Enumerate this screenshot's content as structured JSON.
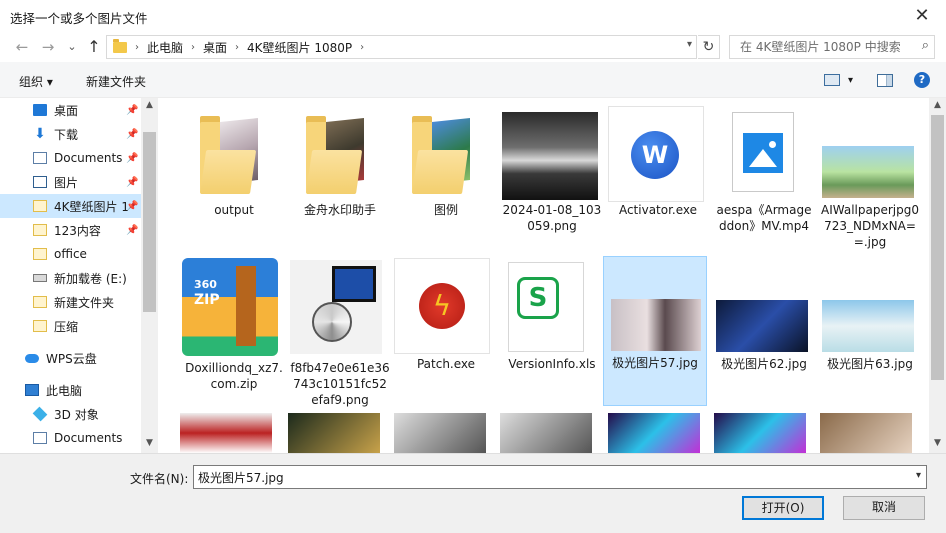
{
  "window": {
    "title": "选择一个或多个图片文件",
    "close": "✕"
  },
  "nav": {
    "back": "←",
    "forward": "→",
    "recent": "⌄",
    "up": "↑",
    "breadcrumbs": [
      "此电脑",
      "桌面",
      "4K壁纸图片 1080P"
    ],
    "separator": "›",
    "refresh": "↻",
    "search_placeholder": "在 4K壁纸图片 1080P 中搜索",
    "search_icon": "⌕"
  },
  "toolbar": {
    "organize": "组织 ▾",
    "new_folder": "新建文件夹",
    "view_dd": "▾",
    "help": "?"
  },
  "sidebar": {
    "items": [
      {
        "label": "桌面",
        "icon": "desktop-icon",
        "pinned": true
      },
      {
        "label": "下载",
        "icon": "download-icon",
        "pinned": true
      },
      {
        "label": "Documents",
        "icon": "document-icon",
        "pinned": true
      },
      {
        "label": "图片",
        "icon": "pictures-icon",
        "pinned": true
      },
      {
        "label": "4K壁纸图片 1",
        "icon": "folder-icon",
        "pinned": true
      },
      {
        "label": "123内容",
        "icon": "folder-icon",
        "pinned": true
      },
      {
        "label": "office",
        "icon": "folder-icon",
        "pinned": false
      },
      {
        "label": "新加载卷 (E:)",
        "icon": "drive-icon",
        "pinned": false
      },
      {
        "label": "新建文件夹",
        "icon": "folder-icon",
        "pinned": false
      },
      {
        "label": "压缩",
        "icon": "folder-icon",
        "pinned": false
      },
      {
        "label": "WPS云盘",
        "icon": "cloud-icon",
        "pinned": false
      },
      {
        "label": "此电脑",
        "icon": "pc-icon",
        "pinned": false
      },
      {
        "label": "3D 对象",
        "icon": "3d-objects-icon",
        "pinned": false
      },
      {
        "label": "Documents",
        "icon": "document-icon",
        "pinned": false
      }
    ],
    "pin": "📌"
  },
  "files": [
    {
      "name": "output"
    },
    {
      "name": "金舟水印助手"
    },
    {
      "name": "图例"
    },
    {
      "name": "2024-01-08_103059.png"
    },
    {
      "name": "Activator.exe",
      "glyph": "W"
    },
    {
      "name": "aespa《Armageddon》MV.mp4"
    },
    {
      "name": "AIWallpaperjpg0723_NDMxNA==.jpg"
    },
    {
      "name": "Doxilliondq_xz7.com.zip",
      "brand": "360",
      "sub": "ZIP"
    },
    {
      "name": "f8fb47e0e61e36743c10151fc52efaf9.png"
    },
    {
      "name": "Patch.exe"
    },
    {
      "name": "VersionInfo.xls",
      "glyph": "S"
    },
    {
      "name": "极光图片57.jpg"
    },
    {
      "name": "极光图片62.jpg"
    },
    {
      "name": "极光图片63.jpg"
    }
  ],
  "bottom": {
    "filename_label": "文件名(N):",
    "filename_value": "极光图片57.jpg",
    "open": "打开(O)",
    "cancel": "取消"
  },
  "colors": {
    "selection": "#cce8ff",
    "accent": "#0078d7"
  }
}
